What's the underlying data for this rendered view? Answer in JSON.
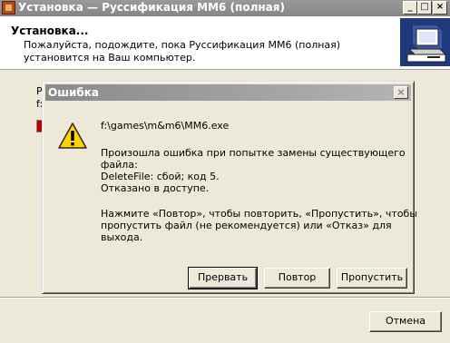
{
  "window": {
    "title": "Установка — Руссификация ММ6 (полная)",
    "minimize_symbol": "_",
    "maximize_symbol": "□",
    "close_symbol": "×"
  },
  "header": {
    "title": "Установка...",
    "description": "Пожалуйста, подождите, пока Руссификация ММ6 (полная) установится на Ваш компьютер."
  },
  "background": {
    "label_1": "Р",
    "label_2": "f:"
  },
  "footer": {
    "cancel_label": "Отмена"
  },
  "dialog": {
    "title": "Ошибка",
    "close_symbol": "×",
    "path": "f:\\games\\m&m6\\MM6.exe",
    "error_line_1": "Произошла ошибка при попытке замены существующего",
    "error_line_2": "файла:",
    "error_line_3": "DeleteFile: сбой; код 5.",
    "error_line_4": "Отказано в доступе.",
    "hint_line_1": "Нажмите «Повтор», чтобы повторить, «Пропустить», чтобы",
    "hint_line_2": "пропустить файл (не рекомендуется) или «Отказ» для",
    "hint_line_3": "выхода.",
    "buttons": {
      "abort": "Прервать",
      "retry": "Повтор",
      "skip": "Пропустить"
    }
  },
  "icons": {
    "app": "installer-app-icon",
    "logo": "computer-install-logo",
    "warning": "warning-triangle-icon"
  },
  "colors": {
    "titlebar_inactive": "#8a8a8a",
    "face": "#ece9d8",
    "progress_red": "#c00000",
    "warning_yellow": "#ffd200"
  }
}
